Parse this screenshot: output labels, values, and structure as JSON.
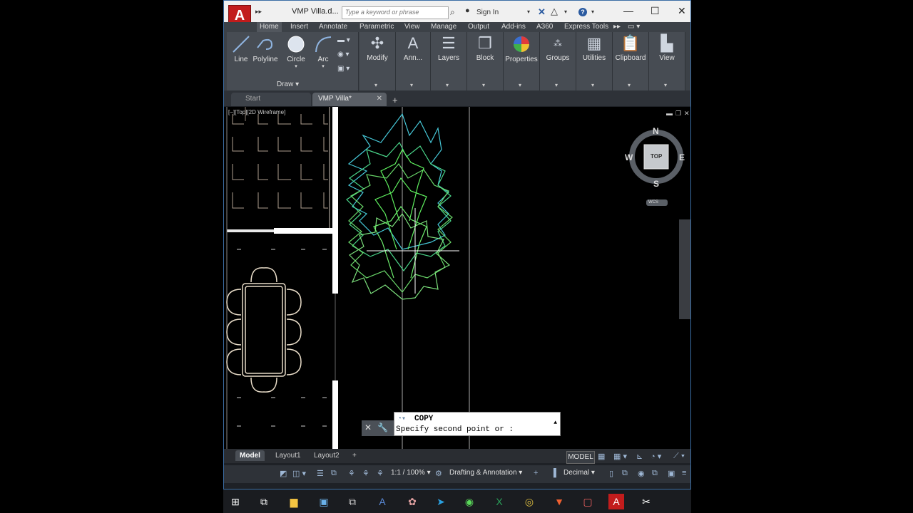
{
  "window": {
    "title": "VMP Villa.d...",
    "logo": "A",
    "search_placeholder": "Type a keyword or phrase",
    "signin": "Sign In",
    "help": "?"
  },
  "ribbon_tabs": [
    "Home",
    "Insert",
    "Annotate",
    "Parametric",
    "View",
    "Manage",
    "Output",
    "Add-ins",
    "A360",
    "Express Tools"
  ],
  "draw_panel": {
    "tools": [
      "Line",
      "Polyline",
      "Circle",
      "Arc"
    ],
    "label": "Draw"
  },
  "panels": [
    "Modify",
    "Ann...",
    "Layers",
    "Block",
    "Properties",
    "Groups",
    "Utilities",
    "Clipboard",
    "View"
  ],
  "file_tabs": {
    "start": "Start",
    "active": "VMP Villa*"
  },
  "viewport": {
    "label": "[−][Top][2D Wireframe]",
    "viewcube": {
      "top": "TOP",
      "n": "N",
      "s": "S",
      "e": "E",
      "w": "W",
      "wcs": "WCS"
    }
  },
  "command": {
    "name": "COPY",
    "prompt": "Specify second point or :"
  },
  "layout_tabs": [
    "Model",
    "Layout1",
    "Layout2"
  ],
  "status": {
    "model": "MODEL",
    "scale": "1:1 / 100%",
    "workspace": "Drafting & Annotation",
    "units": "Decimal"
  },
  "icons": [
    "search-icon",
    "user-icon",
    "exchange-icon",
    "a360-icon",
    "help-icon",
    "minimize-icon",
    "maximize-icon",
    "close-icon",
    "line-icon",
    "polyline-icon",
    "circle-icon",
    "arc-icon",
    "windows-start-icon",
    "task-view-icon",
    "folder-icon",
    "chrome-icon",
    "brave-icon",
    "telegram-icon",
    "wechat-icon",
    "excel-icon",
    "autocad-icon"
  ],
  "colors": {
    "accent": "#c21c1c",
    "ribbon": "#3c4147",
    "canvas": "#000000"
  }
}
